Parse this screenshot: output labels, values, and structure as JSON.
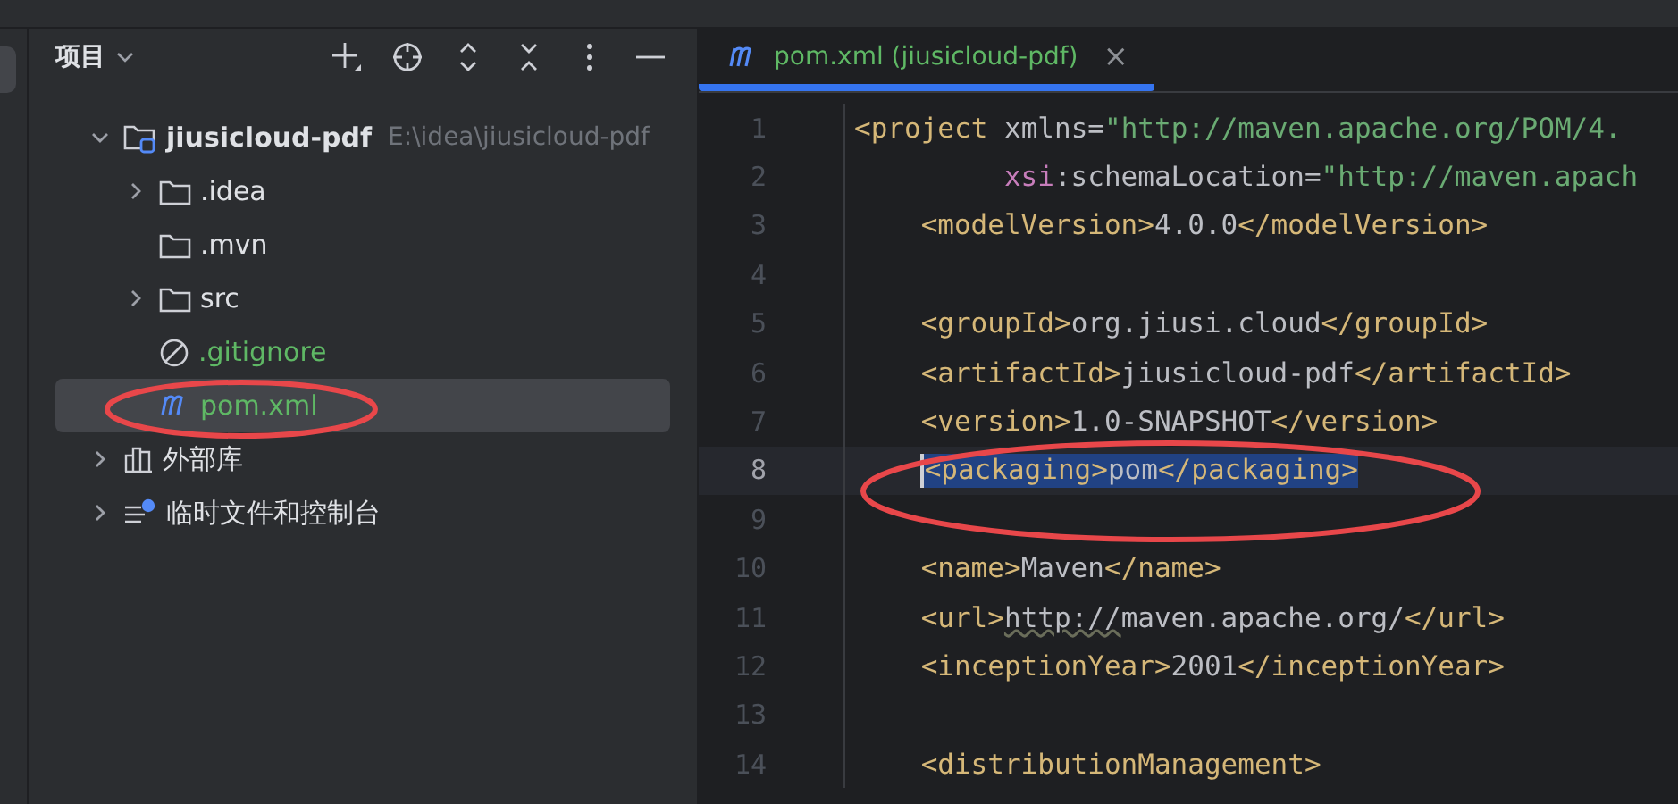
{
  "project_panel": {
    "title": "项目",
    "tree": [
      {
        "kind": "module",
        "label": "jiusicloud-pdf",
        "path": "E:\\idea\\jiusicloud-pdf",
        "expanded": true,
        "selected": false,
        "color": "#dfe1e5",
        "children": [
          {
            "kind": "folder",
            "label": ".idea",
            "expanded": false,
            "selected": false,
            "color": "#dfe1e5"
          },
          {
            "kind": "folder",
            "label": ".mvn",
            "selected": false,
            "color": "#dfe1e5"
          },
          {
            "kind": "folder",
            "label": "src",
            "expanded": false,
            "selected": false,
            "color": "#dfe1e5"
          },
          {
            "kind": "ignore",
            "label": ".gitignore",
            "selected": false,
            "color": "#5fb865"
          },
          {
            "kind": "maven",
            "label": "pom.xml",
            "selected": true,
            "color": "#5fb865"
          }
        ]
      },
      {
        "kind": "library",
        "label": "外部库",
        "expanded": false,
        "selected": false,
        "color": "#dfe1e5"
      },
      {
        "kind": "scratch",
        "label": "临时文件和控制台",
        "expanded": false,
        "selected": false,
        "color": "#dfe1e5"
      }
    ]
  },
  "editor": {
    "tabs": [
      {
        "label": "pom.xml (jiusicloud-pdf)",
        "close": "×",
        "selected": true
      }
    ],
    "lines": [
      {
        "number": "1",
        "kind": "root",
        "selected": false,
        "segments": [
          {
            "kind": "tag",
            "text": "<project "
          },
          {
            "kind": "attr",
            "text": "xmlns="
          },
          {
            "kind": "value",
            "text": "\"http://maven.apache.org/POM/4."
          }
        ]
      },
      {
        "number": "2",
        "kind": "attribute",
        "selected": false,
        "segments": [
          {
            "kind": "ns",
            "text": "xsi"
          },
          {
            "kind": "attr",
            "text": ":schemaLocation="
          },
          {
            "kind": "value",
            "text": "\"http://maven.apach"
          }
        ]
      },
      {
        "number": "3",
        "kind": "child",
        "selected": false,
        "segments": [
          {
            "kind": "tag",
            "text": "<modelVersion>"
          },
          {
            "kind": "text",
            "text": "4.0.0"
          },
          {
            "kind": "tag",
            "text": "</modelVersion>"
          }
        ]
      },
      {
        "number": "4",
        "kind": "blank",
        "selected": false
      },
      {
        "number": "5",
        "kind": "child",
        "selected": false,
        "segments": [
          {
            "kind": "tag",
            "text": "<groupId>"
          },
          {
            "kind": "text",
            "text": "org.jiusi.cloud"
          },
          {
            "kind": "tag",
            "text": "</groupId>"
          }
        ]
      },
      {
        "number": "6",
        "kind": "child",
        "selected": false,
        "segments": [
          {
            "kind": "tag",
            "text": "<artifactId>"
          },
          {
            "kind": "text",
            "text": "jiusicloud-pdf"
          },
          {
            "kind": "tag",
            "text": "</artifactId>"
          }
        ]
      },
      {
        "number": "7",
        "kind": "child",
        "selected": false,
        "segments": [
          {
            "kind": "tag",
            "text": "<version>"
          },
          {
            "kind": "text",
            "text": "1.0-SNAPSHOT"
          },
          {
            "kind": "tag",
            "text": "</version>"
          }
        ]
      },
      {
        "number": "8",
        "kind": "child",
        "selected": true,
        "segments": [
          {
            "kind": "tag",
            "text": "<packaging>"
          },
          {
            "kind": "text",
            "text": "pom"
          },
          {
            "kind": "tag",
            "text": "</packaging>"
          }
        ]
      },
      {
        "number": "9",
        "kind": "blank",
        "selected": false
      },
      {
        "number": "10",
        "kind": "child",
        "selected": false,
        "segments": [
          {
            "kind": "tag",
            "text": "<name>"
          },
          {
            "kind": "text",
            "text": "Maven"
          },
          {
            "kind": "tag",
            "text": "</name>"
          }
        ]
      },
      {
        "number": "11",
        "kind": "child",
        "selected": false,
        "segments": [
          {
            "kind": "tag",
            "text": "<url>"
          },
          {
            "kind": "link",
            "text": "http://"
          },
          {
            "kind": "text",
            "text": "maven.apache.org/"
          },
          {
            "kind": "tag",
            "text": "</url>"
          }
        ]
      },
      {
        "number": "12",
        "kind": "child",
        "selected": false,
        "segments": [
          {
            "kind": "tag",
            "text": "<inceptionYear>"
          },
          {
            "kind": "text",
            "text": "2001"
          },
          {
            "kind": "tag",
            "text": "</inceptionYear>"
          }
        ]
      },
      {
        "number": "13",
        "kind": "blank",
        "selected": false
      },
      {
        "number": "14",
        "kind": "child",
        "selected": false,
        "segments": [
          {
            "kind": "tag",
            "text": "<distributionManagement>"
          }
        ]
      }
    ]
  },
  "annotations": [
    {
      "kind": "ellipse"
    },
    {
      "kind": "ellipse"
    }
  ]
}
